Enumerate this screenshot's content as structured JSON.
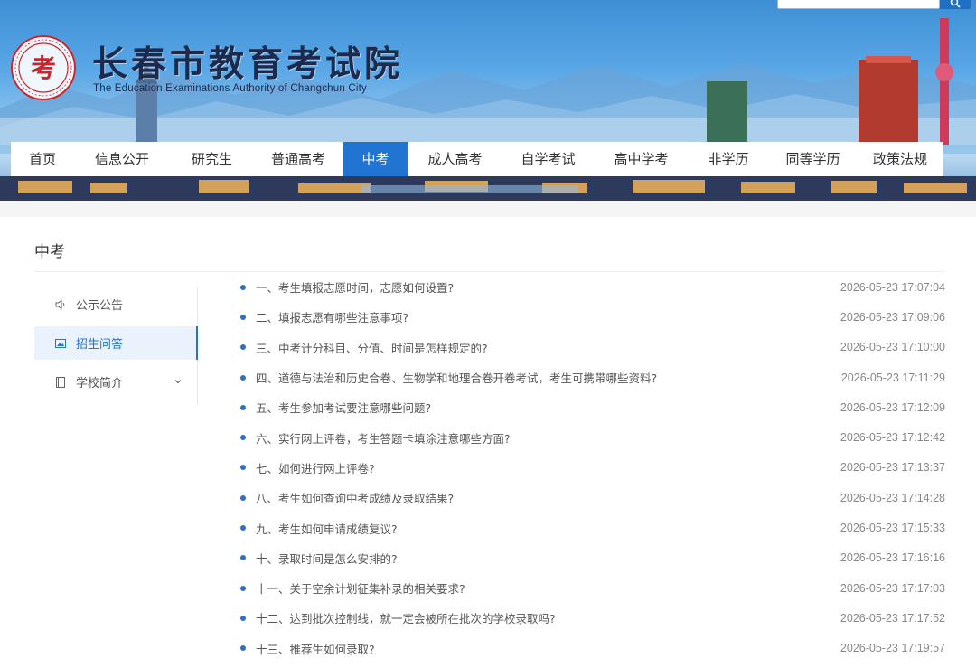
{
  "header": {
    "title": "长春市教育考试院",
    "subtitle": "The Education Examinations Authority of Changchun City",
    "seal_char": "考"
  },
  "search": {
    "placeholder": "",
    "icon": "search-icon"
  },
  "nav": {
    "items": [
      "首页",
      "信息公开",
      "研究生",
      "普通高考",
      "中考",
      "成人高考",
      "自学考试",
      "高中学考",
      "非学历",
      "同等学历",
      "政策法规"
    ],
    "active": "中考"
  },
  "page": {
    "title": "中考"
  },
  "sidebar": {
    "items": [
      {
        "label": "公示公告",
        "icon": "speaker-icon"
      },
      {
        "label": "招生问答",
        "icon": "photo-icon",
        "active": true
      },
      {
        "label": "学校简介",
        "icon": "document-icon",
        "has_dropdown": true
      }
    ]
  },
  "articles": [
    {
      "title": "一、考生填报志愿时间，志愿如何设置?",
      "date": "2026-05-23 17:07:04"
    },
    {
      "title": "二、填报志愿有哪些注意事项?",
      "date": "2026-05-23 17:09:06"
    },
    {
      "title": "三、中考计分科目、分值、时间是怎样规定的?",
      "date": "2026-05-23 17:10:00"
    },
    {
      "title": "四、道德与法治和历史合卷、生物学和地理合卷开卷考试，考生可携带哪些资料?",
      "date": "2026-05-23 17:11:29"
    },
    {
      "title": "五、考生参加考试要注意哪些问题?",
      "date": "2026-05-23 17:12:09"
    },
    {
      "title": "六、实行网上评卷，考生答题卡填涂注意哪些方面?",
      "date": "2026-05-23 17:12:42"
    },
    {
      "title": "七、如何进行网上评卷?",
      "date": "2026-05-23 17:13:37"
    },
    {
      "title": "八、考生如何查询中考成绩及录取结果?",
      "date": "2026-05-23 17:14:28"
    },
    {
      "title": "九、考生如何申请成绩复议?",
      "date": "2026-05-23 17:15:33"
    },
    {
      "title": "十、录取时间是怎么安排的?",
      "date": "2026-05-23 17:16:16"
    },
    {
      "title": "十一、关于空余计划征集补录的相关要求?",
      "date": "2026-05-23 17:17:03"
    },
    {
      "title": "十二、达到批次控制线，就一定会被所在批次的学校录取吗?",
      "date": "2026-05-23 17:17:52"
    },
    {
      "title": "十三、推荐生如何录取?",
      "date": "2026-05-23 17:19:57"
    }
  ],
  "colors": {
    "accent": "#1f75d1",
    "bullet": "#2f6fc2",
    "seal_red": "#c8262d"
  }
}
